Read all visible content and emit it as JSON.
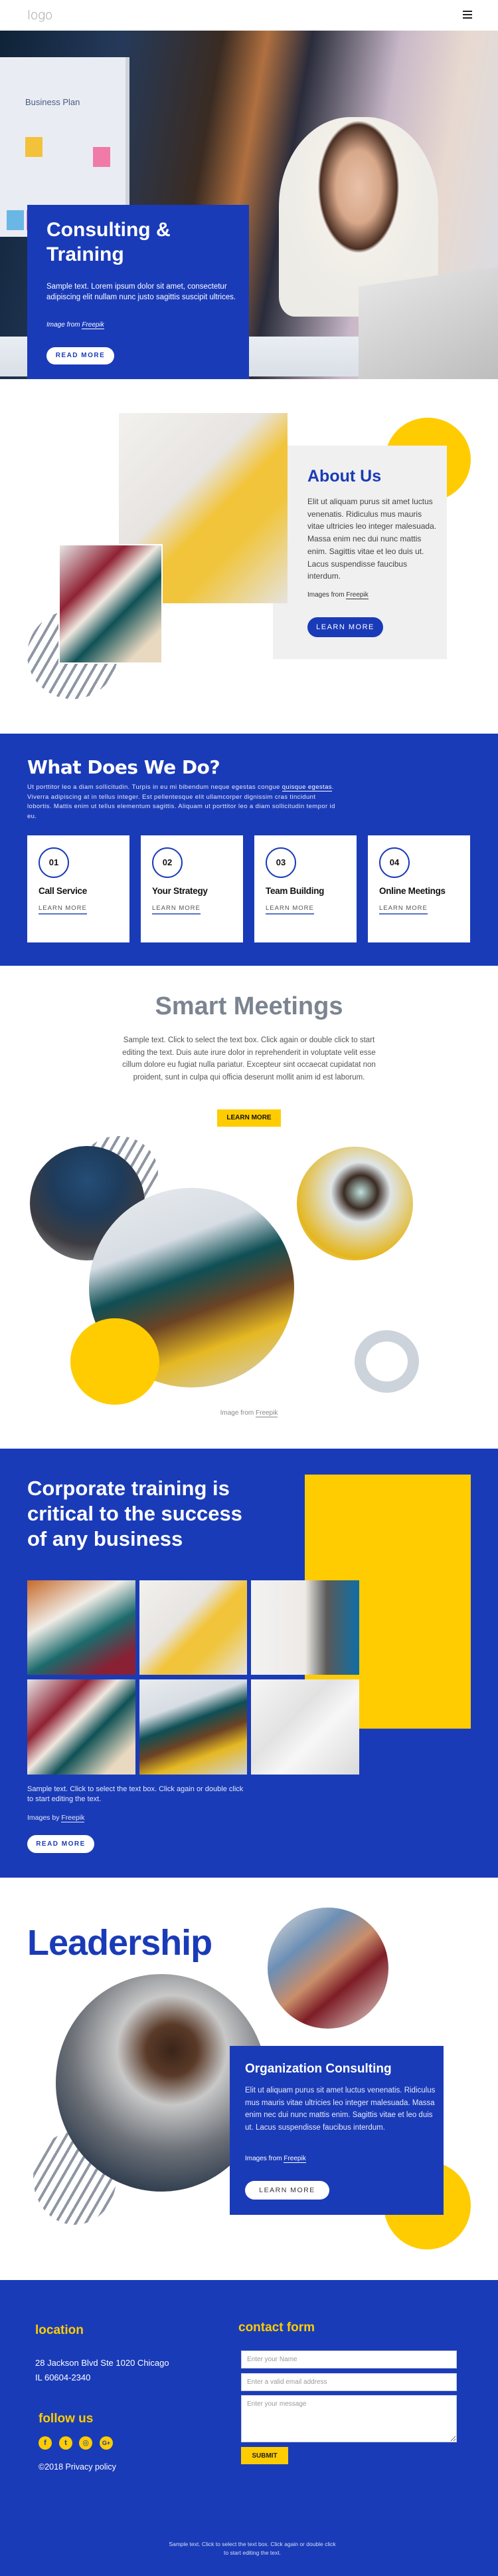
{
  "header": {
    "logo": "logo",
    "menu_icon": "hamburger-menu-icon"
  },
  "hero": {
    "title": "Consulting & Training",
    "text": "Sample text. Lorem ipsum dolor sit amet, consectetur adipiscing elit nullam nunc justo sagittis suscipit ultrices.",
    "credit_prefix": "Image from ",
    "credit_link": "Freepik",
    "button": "READ MORE",
    "board_title": "Business Plan"
  },
  "about": {
    "title": "About Us",
    "text": "Elit ut aliquam purus sit amet luctus venenatis. Ridiculus mus mauris vitae ultricies leo integer malesuada. Massa enim nec dui nunc mattis enim. Sagittis vitae et leo duis ut. Lacus suspendisse faucibus interdum.",
    "credit_prefix": "Images from ",
    "credit_link": "Freepik",
    "button": "LEARN MORE"
  },
  "services": {
    "title": "What Does We Do?",
    "text_before_link": "Ut porttitor leo a diam sollicitudin. Turpis in eu mi bibendum neque egestas congue ",
    "link": "quisque egestas",
    "text_after_link": ". Viverra adipiscing at in tellus integer. Est pellentesque elit ullamcorper dignissim cras tincidunt lobortis. Mattis enim ut tellus elementum sagittis. Aliquam ut porttitor leo a diam sollicitudin tempor id eu.",
    "cards": [
      {
        "number": "01",
        "title": "Call Service",
        "link": "LEARN MORE"
      },
      {
        "number": "02",
        "title": "Your Strategy",
        "link": "LEARN MORE"
      },
      {
        "number": "03",
        "title": "Team Building",
        "link": "LEARN MORE"
      },
      {
        "number": "04",
        "title": "Online Meetings",
        "link": "LEARN MORE"
      }
    ]
  },
  "smart_meetings": {
    "title": "Smart Meetings",
    "text": "Sample text. Click to select the text box. Click again or double click to start editing the text. Duis aute irure dolor in reprehenderit in voluptate velit esse cillum dolore eu fugiat nulla pariatur. Excepteur sint occaecat cupidatat non proident, sunt in culpa qui officia deserunt mollit anim id est laborum.",
    "button": "LEARN MORE",
    "credit_prefix": "Image from ",
    "credit_link": "Freepik"
  },
  "corporate": {
    "title": "Corporate training is critical to the success of any business",
    "text": "Sample text. Click to select the text box. Click again or double click to start editing the text.",
    "credit_prefix": "Images by ",
    "credit_link": "Freepik",
    "button": "READ MORE"
  },
  "leadership": {
    "title": "Leadership",
    "box_title": "Organization Consulting",
    "box_text": "Elit ut aliquam purus sit amet luctus venenatis. Ridiculus mus mauris vitae ultricies leo integer malesuada. Massa enim nec dui nunc mattis enim. Sagittis vitae et leo duis ut. Lacus suspendisse faucibus interdum.",
    "credit_prefix": "Images from ",
    "credit_link": "Freepik",
    "button": "LEARN MORE"
  },
  "footer": {
    "location_title": "location",
    "address_line1": "28 Jackson Blvd Ste 1020 Chicago",
    "address_line2": "IL 60604-2340",
    "follow_title": "follow us",
    "social": [
      {
        "name": "facebook-icon",
        "glyph": "f"
      },
      {
        "name": "twitter-icon",
        "glyph": "t"
      },
      {
        "name": "instagram-icon",
        "glyph": "◎"
      },
      {
        "name": "google-plus-icon",
        "glyph": "G+"
      }
    ],
    "privacy": "©2018 Privacy policy",
    "contact_title": "contact form",
    "name_placeholder": "Enter your Name",
    "email_placeholder": "Enter a valid email address",
    "message_placeholder": "Enter your message",
    "submit": "SUBMIT",
    "bottom_text": "Sample text. Click to select the text box. Click again or double click to start editing the text."
  },
  "colors": {
    "brand_blue": "#1a3bb8",
    "accent_yellow": "#fecc00",
    "gray_title": "#7b8490"
  }
}
